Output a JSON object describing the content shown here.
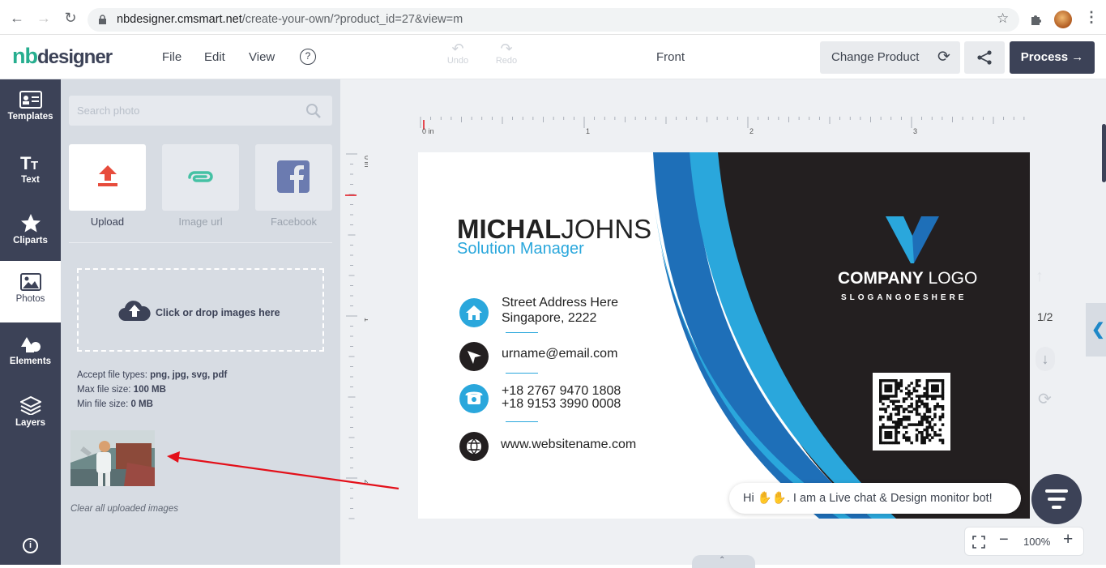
{
  "browser": {
    "url_host": "nbdesigner.cmsmart.net",
    "url_path": "/create-your-own/?product_id=27&view=m"
  },
  "header": {
    "logo_nb": "nb",
    "logo_designer": "designer",
    "menu": [
      "File",
      "Edit",
      "View"
    ],
    "undo_label": "Undo",
    "redo_label": "Redo",
    "side_label": "Front",
    "change_product": "Change Product",
    "process": "Process"
  },
  "sidebar": {
    "items": [
      "Templates",
      "Text",
      "Cliparts",
      "Photos",
      "Elements",
      "Layers"
    ]
  },
  "panel": {
    "search_placeholder": "Search photo",
    "tabs": [
      "Upload",
      "Image url",
      "Facebook"
    ],
    "drop_text": "Click or drop images here",
    "file_types_label": "Accept file types: ",
    "file_types": "png, jpg, svg, pdf",
    "max_size_label": "Max file size: ",
    "max_size": "100 MB",
    "min_size_label": "Min file size: ",
    "min_size": "0 MB",
    "clear_all": "Clear all uploaded images"
  },
  "ruler": {
    "h_labels": [
      "0 in",
      "1",
      "2",
      "3"
    ],
    "v_labels": [
      "0 in",
      "1",
      "2"
    ]
  },
  "card": {
    "first_name": "MICHAL",
    "last_name": "JOHNS",
    "job_title": "Solution Manager",
    "address1": "Street Address Here",
    "address2": "Singapore, 2222",
    "email": "urname@email.com",
    "phone1": "+18 2767 9470 1808",
    "phone2": "+18 9153 3990 0008",
    "website": "www.websitename.com",
    "company": "COMPANY",
    "logo": "LOGO",
    "slogan": "SLOGANGOESHERE"
  },
  "page_indicator": "1/2",
  "chat": {
    "greeting_pre": "Hi ",
    "greeting_post": ". I am a Live chat & Design monitor bot!"
  },
  "zoom": "100%",
  "colors": {
    "sidebar": "#3c4257",
    "panel": "#d7dce3",
    "accent_blue": "#2aa7dc",
    "logo_green": "#27ae8f",
    "upload_red": "#e74c3c",
    "card_dark": "#231f20",
    "arrow_red": "#e3101a"
  }
}
